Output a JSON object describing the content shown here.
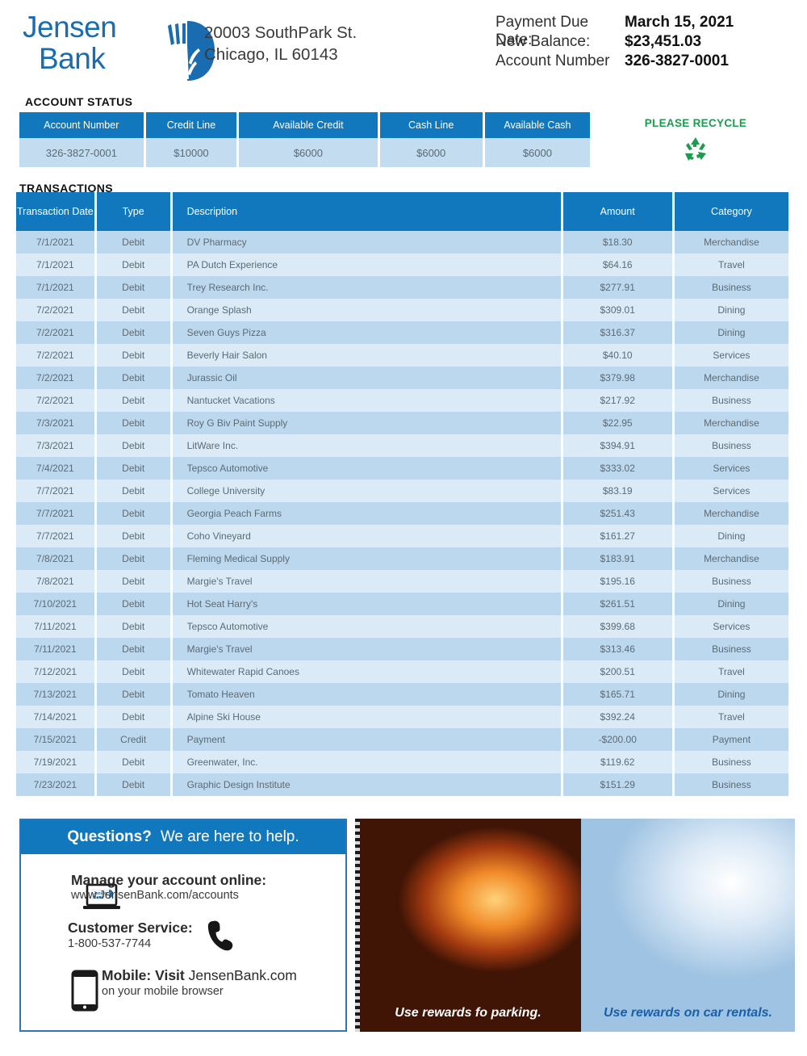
{
  "brand": {
    "name_line1": "Jensen",
    "name_line2": "Bank",
    "logo_icon": "wheat-sheaf-logo-icon",
    "accent_blue": "#1278be",
    "logo_blue": "#1a6cb0",
    "recycle_green": "#1d9b4e"
  },
  "header": {
    "address_line1": "20003 SouthPark St.",
    "address_line2": "Chicago, IL 60143",
    "summary": [
      {
        "label": "Payment Due Date:",
        "value": "March 15, 2021"
      },
      {
        "label": "New Balance:",
        "value": "$23,451.03"
      },
      {
        "label": "Account Number",
        "value": "326-3827-0001"
      }
    ]
  },
  "account_status": {
    "title": "ACCOUNT STATUS",
    "columns": [
      "Account Number",
      "Credit Line",
      "Available Credit",
      "Cash Line",
      "Available Cash"
    ],
    "values": [
      "326-3827-0001",
      "$10000",
      "$6000",
      "$6000",
      "$6000"
    ]
  },
  "recycle": {
    "text": "PLEASE RECYCLE",
    "icon": "recycle-icon"
  },
  "transactions": {
    "title": "TRANSACTIONS",
    "columns": [
      "Transaction Date",
      "Type",
      "Description",
      "Amount",
      "Category"
    ],
    "rows": [
      {
        "date": "7/1/2021",
        "type": "Debit",
        "description": "DV Pharmacy",
        "amount": "$18.30",
        "category": "Merchandise"
      },
      {
        "date": "7/1/2021",
        "type": "Debit",
        "description": "PA Dutch Experience",
        "amount": "$64.16",
        "category": "Travel"
      },
      {
        "date": "7/1/2021",
        "type": "Debit",
        "description": "Trey Research Inc.",
        "amount": "$277.91",
        "category": "Business"
      },
      {
        "date": "7/2/2021",
        "type": "Debit",
        "description": "Orange Splash",
        "amount": "$309.01",
        "category": "Dining"
      },
      {
        "date": "7/2/2021",
        "type": "Debit",
        "description": "Seven Guys Pizza",
        "amount": "$316.37",
        "category": "Dining"
      },
      {
        "date": "7/2/2021",
        "type": "Debit",
        "description": "Beverly Hair Salon",
        "amount": "$40.10",
        "category": "Services"
      },
      {
        "date": "7/2/2021",
        "type": "Debit",
        "description": "Jurassic Oil",
        "amount": "$379.98",
        "category": "Merchandise"
      },
      {
        "date": "7/2/2021",
        "type": "Debit",
        "description": "Nantucket Vacations",
        "amount": "$217.92",
        "category": "Business"
      },
      {
        "date": "7/3/2021",
        "type": "Debit",
        "description": "Roy G Biv Paint Supply",
        "amount": "$22.95",
        "category": "Merchandise"
      },
      {
        "date": "7/3/2021",
        "type": "Debit",
        "description": "LitWare Inc.",
        "amount": "$394.91",
        "category": "Business"
      },
      {
        "date": "7/4/2021",
        "type": "Debit",
        "description": "Tepsco Automotive",
        "amount": "$333.02",
        "category": "Services"
      },
      {
        "date": "7/7/2021",
        "type": "Debit",
        "description": "College University",
        "amount": "$83.19",
        "category": "Services"
      },
      {
        "date": "7/7/2021",
        "type": "Debit",
        "description": "Georgia Peach Farms",
        "amount": "$251.43",
        "category": "Merchandise"
      },
      {
        "date": "7/7/2021",
        "type": "Debit",
        "description": "Coho Vineyard",
        "amount": "$161.27",
        "category": "Dining"
      },
      {
        "date": "7/8/2021",
        "type": "Debit",
        "description": "Fleming Medical Supply",
        "amount": "$183.91",
        "category": "Merchandise"
      },
      {
        "date": "7/8/2021",
        "type": "Debit",
        "description": "Margie's Travel",
        "amount": "$195.16",
        "category": "Business"
      },
      {
        "date": "7/10/2021",
        "type": "Debit",
        "description": "Hot Seat Harry's",
        "amount": "$261.51",
        "category": "Dining"
      },
      {
        "date": "7/11/2021",
        "type": "Debit",
        "description": "Tepsco Automotive",
        "amount": "$399.68",
        "category": "Services"
      },
      {
        "date": "7/11/2021",
        "type": "Debit",
        "description": "Margie's Travel",
        "amount": "$313.46",
        "category": "Business"
      },
      {
        "date": "7/12/2021",
        "type": "Debit",
        "description": "Whitewater Rapid Canoes",
        "amount": "$200.51",
        "category": "Travel"
      },
      {
        "date": "7/13/2021",
        "type": "Debit",
        "description": "Tomato Heaven",
        "amount": "$165.71",
        "category": "Dining"
      },
      {
        "date": "7/14/2021",
        "type": "Debit",
        "description": "Alpine Ski House",
        "amount": "$392.24",
        "category": "Travel"
      },
      {
        "date": "7/15/2021",
        "type": "Credit",
        "description": "Payment",
        "amount": "-$200.00",
        "category": "Payment"
      },
      {
        "date": "7/19/2021",
        "type": "Debit",
        "description": "Greenwater, Inc.",
        "amount": "$119.62",
        "category": "Business"
      },
      {
        "date": "7/23/2021",
        "type": "Debit",
        "description": "Graphic Design Institute",
        "amount": "$151.29",
        "category": "Business"
      }
    ]
  },
  "questions": {
    "bar_strong": "Questions?",
    "bar_rest": "We are here to help.",
    "online": {
      "icon": "laptop-icon",
      "title": "Manage your account online:",
      "subtitle": "www.JensenBank.com/accounts"
    },
    "customer_service": {
      "icon": "phone-icon",
      "title": "Customer Service:",
      "subtitle": "1-800-537-7744"
    },
    "mobile": {
      "icon": "mobile-phone-icon",
      "title_strong": "Mobile:  Visit",
      "title_rest": "JensenBank.com",
      "subtitle": "on your mobile browser"
    }
  },
  "promos": [
    {
      "caption": "Use rewards fo parking.",
      "image": "parking-meter-car-night-photo"
    },
    {
      "caption": "Use rewards on car rentals.",
      "image": "car-keys-photo"
    }
  ]
}
